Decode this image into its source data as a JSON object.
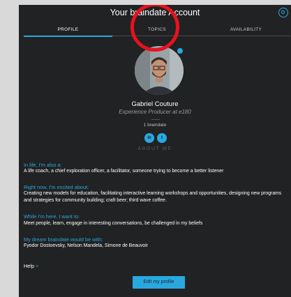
{
  "header": {
    "title": "Your braindate Account"
  },
  "tabs": [
    {
      "label": "PROFILE",
      "active": true
    },
    {
      "label": "TOPICS",
      "active": false
    },
    {
      "label": "AVAILABILITY",
      "active": false
    }
  ],
  "profile": {
    "name": "Gabriel Couture",
    "role": "Experience Producer at e180",
    "braindates": "1 braindate",
    "social": [
      {
        "icon": "linkedin-icon",
        "glyph": "in"
      },
      {
        "icon": "twitter-icon",
        "glyph": "t"
      }
    ]
  },
  "about": {
    "heading": "ABOUT ME",
    "sections": [
      {
        "title": "In life, I'm also a:",
        "body": "A life coach, a chief exploration officer, a facilitator, someone trying to become a better listener"
      },
      {
        "title": "Right now, I'm excited about:",
        "body": "Creating new models for education, facilitating interactive learning workshops and opportunities, designing new programs and strategies for community building; craft beer; third wave coffee."
      },
      {
        "title": "While I'm here, I want to:",
        "body": "Meet people, learn, engage in interesting conversations, be challenged in my beliefs"
      },
      {
        "title": "My dream braindate would be with:",
        "body": "Fyodor Dostoevsky, Nelson Mandela, Simone de Beauvoir"
      }
    ]
  },
  "help": {
    "label": "Help",
    "chevron": ">"
  },
  "edit_button": {
    "label": "Edit my profile"
  },
  "colors": {
    "accent": "#29a8e0",
    "background": "#212223",
    "annotation": "#e8111f"
  }
}
